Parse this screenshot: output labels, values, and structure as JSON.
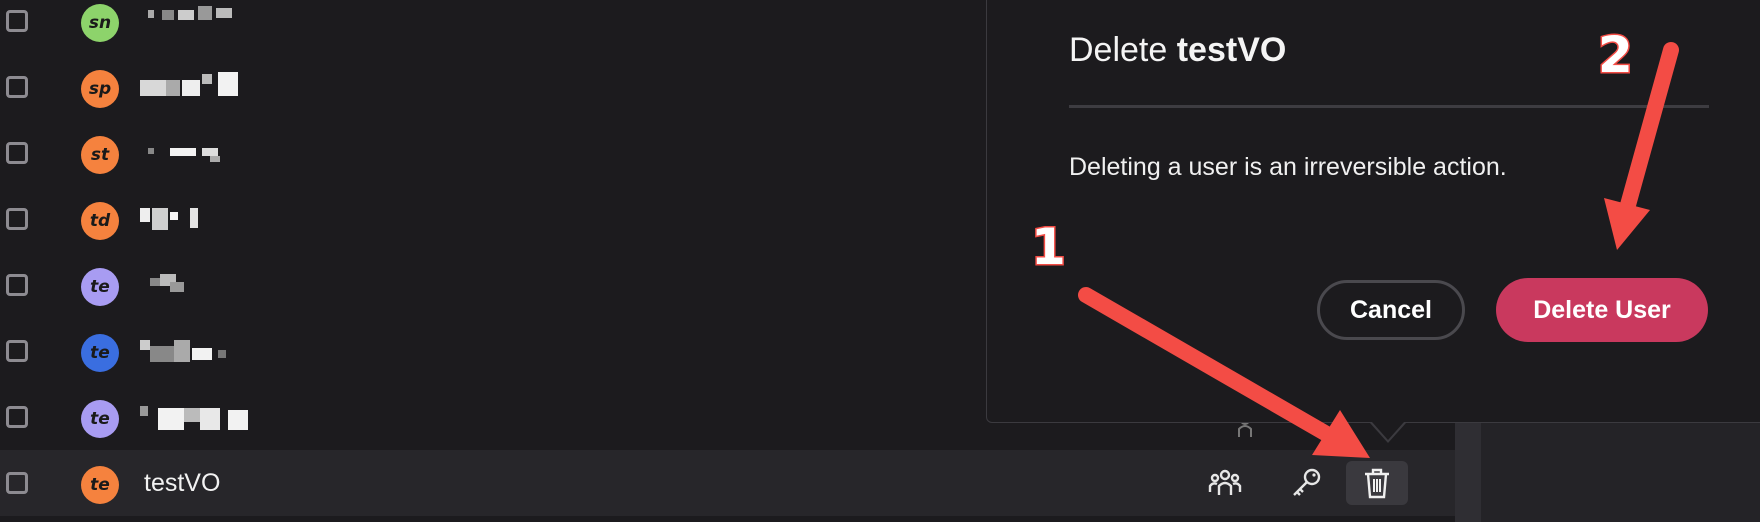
{
  "users": [
    {
      "initials": "sn",
      "color": "#8dd36b",
      "name": ""
    },
    {
      "initials": "sp",
      "color": "#f5823e",
      "name": ""
    },
    {
      "initials": "st",
      "color": "#f5823e",
      "name": ""
    },
    {
      "initials": "td",
      "color": "#f5823e",
      "name": ""
    },
    {
      "initials": "te",
      "color": "#a89cf2",
      "name": ""
    },
    {
      "initials": "te",
      "color": "#3a6ee0",
      "name": ""
    },
    {
      "initials": "te",
      "color": "#a89cf2",
      "name": ""
    },
    {
      "initials": "te",
      "color": "#f5823e",
      "name": "testVO"
    }
  ],
  "row_actions": {
    "groups_icon": "groups-icon",
    "key_icon": "key-icon",
    "trash_icon": "trash-icon"
  },
  "popover": {
    "title_prefix": "Delete",
    "title_user": "testVO",
    "message": "Deleting a user is an irreversible action.",
    "cancel_label": "Cancel",
    "delete_label": "Delete User"
  },
  "annotations": {
    "step1": "1",
    "step2": "2",
    "arrow_color": "#f34c45"
  }
}
